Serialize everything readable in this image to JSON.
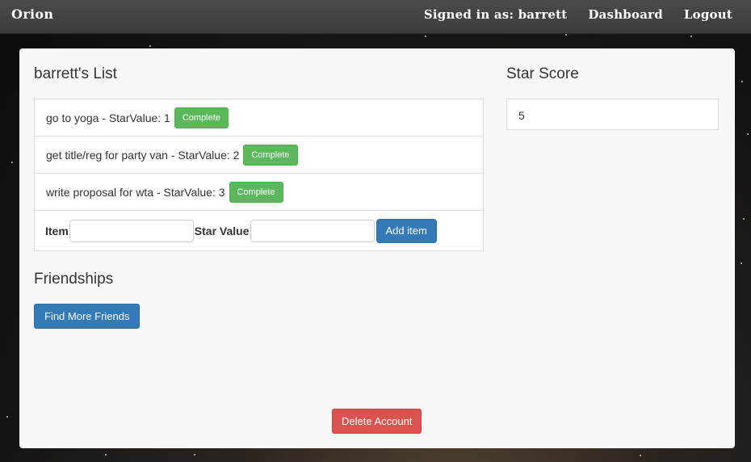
{
  "navbar": {
    "brand": "Orion",
    "signed_in": "Signed in as: barrett",
    "dashboard": "Dashboard",
    "logout": "Logout"
  },
  "list": {
    "title": "barrett's List",
    "items": [
      {
        "text": "go to yoga - StarValue: 1",
        "button": "Complete"
      },
      {
        "text": "get title/reg for party van - StarValue: 2",
        "button": "Complete"
      },
      {
        "text": "write proposal for wta - StarValue: 3",
        "button": "Complete"
      }
    ],
    "form": {
      "item_label": "Item",
      "item_value": "",
      "star_label": "Star Value",
      "star_value": "",
      "add_button": "Add item"
    }
  },
  "score": {
    "title": "Star Score",
    "value": "5"
  },
  "friendships": {
    "title": "Friendships",
    "button": "Find More Friends"
  },
  "delete_button": "Delete Account",
  "colors": {
    "success": "#5cb85c",
    "primary": "#337ab7",
    "danger": "#d9534f",
    "navbar": "#3f3f3f"
  }
}
